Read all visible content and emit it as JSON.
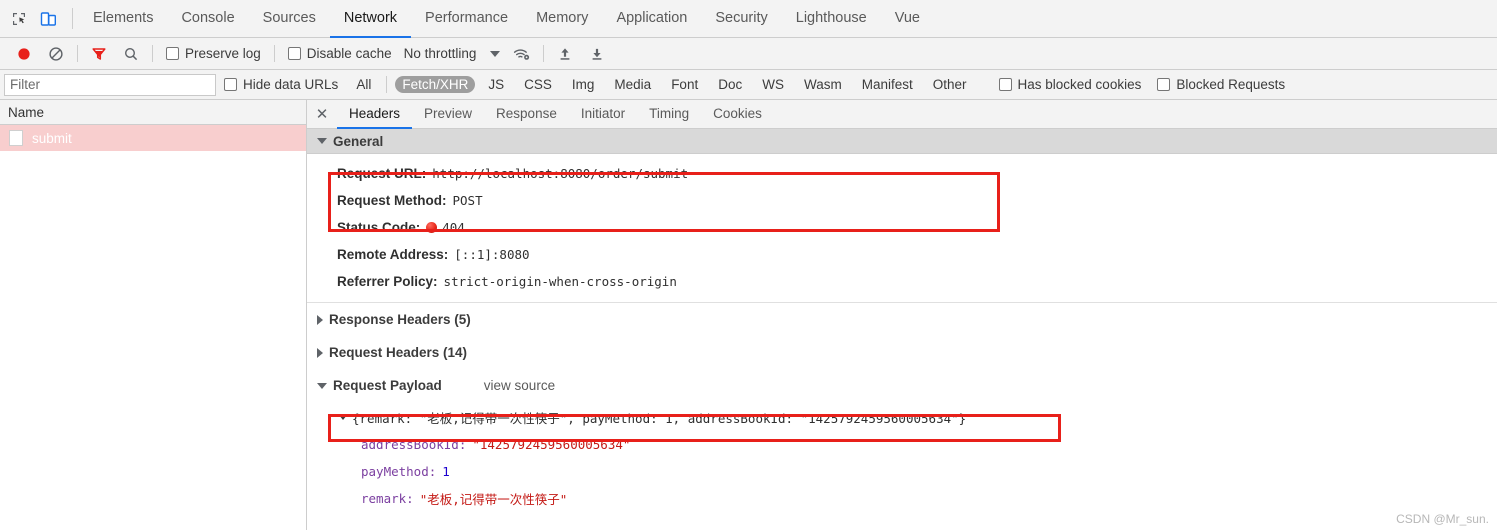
{
  "toolbar_icons": {
    "inspect": "inspect-element-icon",
    "device": "device-toolbar-icon",
    "record": "record-icon",
    "clear": "clear-icon",
    "filter": "filter-funnel-icon",
    "search": "search-icon",
    "network_conditions": "wifi-gear-icon",
    "import_har": "upload-arrow-icon",
    "export_har": "download-arrow-icon"
  },
  "main_tabs": [
    {
      "label": "Elements",
      "active": false
    },
    {
      "label": "Console",
      "active": false
    },
    {
      "label": "Sources",
      "active": false
    },
    {
      "label": "Network",
      "active": true
    },
    {
      "label": "Performance",
      "active": false
    },
    {
      "label": "Memory",
      "active": false
    },
    {
      "label": "Application",
      "active": false
    },
    {
      "label": "Security",
      "active": false
    },
    {
      "label": "Lighthouse",
      "active": false
    },
    {
      "label": "Vue",
      "active": false
    }
  ],
  "controls": {
    "preserve_log_label": "Preserve log",
    "preserve_log_checked": false,
    "disable_cache_label": "Disable cache",
    "disable_cache_checked": false,
    "throttling_value": "No throttling"
  },
  "filter_bar": {
    "filter_placeholder": "Filter",
    "filter_value": "",
    "hide_data_urls_label": "Hide data URLs",
    "hide_data_urls_checked": false,
    "type_chips": [
      {
        "label": "All",
        "active": false
      },
      {
        "label": "Fetch/XHR",
        "active": true
      },
      {
        "label": "JS",
        "active": false
      },
      {
        "label": "CSS",
        "active": false
      },
      {
        "label": "Img",
        "active": false
      },
      {
        "label": "Media",
        "active": false
      },
      {
        "label": "Font",
        "active": false
      },
      {
        "label": "Doc",
        "active": false
      },
      {
        "label": "WS",
        "active": false
      },
      {
        "label": "Wasm",
        "active": false
      },
      {
        "label": "Manifest",
        "active": false
      },
      {
        "label": "Other",
        "active": false
      }
    ],
    "has_blocked_cookies_label": "Has blocked cookies",
    "has_blocked_cookies_checked": false,
    "blocked_requests_label": "Blocked Requests",
    "blocked_requests_checked": false
  },
  "request_list": {
    "column_header": "Name",
    "rows": [
      {
        "name": "submit",
        "status": "error",
        "selected": true
      }
    ]
  },
  "detail_tabs": [
    {
      "label": "Headers",
      "active": true
    },
    {
      "label": "Preview",
      "active": false
    },
    {
      "label": "Response",
      "active": false
    },
    {
      "label": "Initiator",
      "active": false
    },
    {
      "label": "Timing",
      "active": false
    },
    {
      "label": "Cookies",
      "active": false
    }
  ],
  "sections": {
    "general": {
      "title": "General",
      "expanded": true,
      "rows": [
        {
          "key": "Request URL:",
          "value": "http://localhost:8080/order/submit"
        },
        {
          "key": "Request Method:",
          "value": "POST"
        },
        {
          "key": "Status Code:",
          "value": "404",
          "status_dot": "red-status-dot"
        },
        {
          "key": "Remote Address:",
          "value": "[::1]:8080"
        },
        {
          "key": "Referrer Policy:",
          "value": "strict-origin-when-cross-origin"
        }
      ]
    },
    "response_headers": {
      "title": "Response Headers (5)",
      "expanded": false
    },
    "request_headers": {
      "title": "Request Headers (14)",
      "expanded": false
    },
    "request_payload": {
      "title": "Request Payload",
      "view_source_label": "view source",
      "expanded": true,
      "summary": "{remark: \"老板,记得带一次性筷子\", payMethod: 1, addressBookId: \"1425792459560005634\"}",
      "properties": [
        {
          "key": "addressBookId:",
          "value": "\"1425792459560005634\"",
          "type": "string"
        },
        {
          "key": "payMethod:",
          "value": "1",
          "type": "number"
        },
        {
          "key": "remark:",
          "value": "\"老板,记得带一次性筷子\"",
          "type": "string"
        }
      ]
    }
  },
  "annotation_color": "#e8201a",
  "watermark": "CSDN @Mr_sun."
}
